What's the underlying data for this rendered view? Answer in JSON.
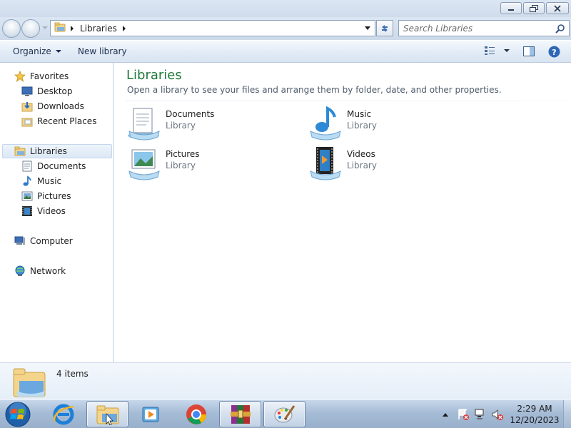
{
  "window": {
    "buttons": {
      "minimize": "minimize-icon",
      "maximize": "restore-icon",
      "close": "close-icon"
    }
  },
  "address": {
    "breadcrumb": [
      "Libraries"
    ],
    "search_placeholder": "Search Libraries"
  },
  "toolbar": {
    "organize_label": "Organize",
    "new_library_label": "New library"
  },
  "nav": {
    "favorites": {
      "label": "Favorites",
      "items": [
        "Desktop",
        "Downloads",
        "Recent Places"
      ]
    },
    "libraries": {
      "label": "Libraries",
      "items": [
        "Documents",
        "Music",
        "Pictures",
        "Videos"
      ]
    },
    "computer": "Computer",
    "network": "Network"
  },
  "content": {
    "title": "Libraries",
    "subtitle": "Open a library to see your files and arrange them by folder, date, and other properties.",
    "libraries": [
      {
        "name": "Documents",
        "type": "Library",
        "icon": "documents-library-icon"
      },
      {
        "name": "Music",
        "type": "Library",
        "icon": "music-library-icon"
      },
      {
        "name": "Pictures",
        "type": "Library",
        "icon": "pictures-library-icon"
      },
      {
        "name": "Videos",
        "type": "Library",
        "icon": "videos-library-icon"
      }
    ]
  },
  "details": {
    "item_count": "4 items"
  },
  "taskbar": {
    "apps": [
      "internet-explorer-icon",
      "file-explorer-icon",
      "media-player-icon",
      "chrome-icon",
      "winrar-icon",
      "paint-icon"
    ],
    "active_app": "file-explorer-icon",
    "clock_time": "2:29 AM",
    "clock_date": "12/20/2023"
  },
  "colors": {
    "title_green": "#1e7a3a",
    "frame_blue": "#dbe6f3",
    "taskbar_blue": "#a6bcd6"
  }
}
